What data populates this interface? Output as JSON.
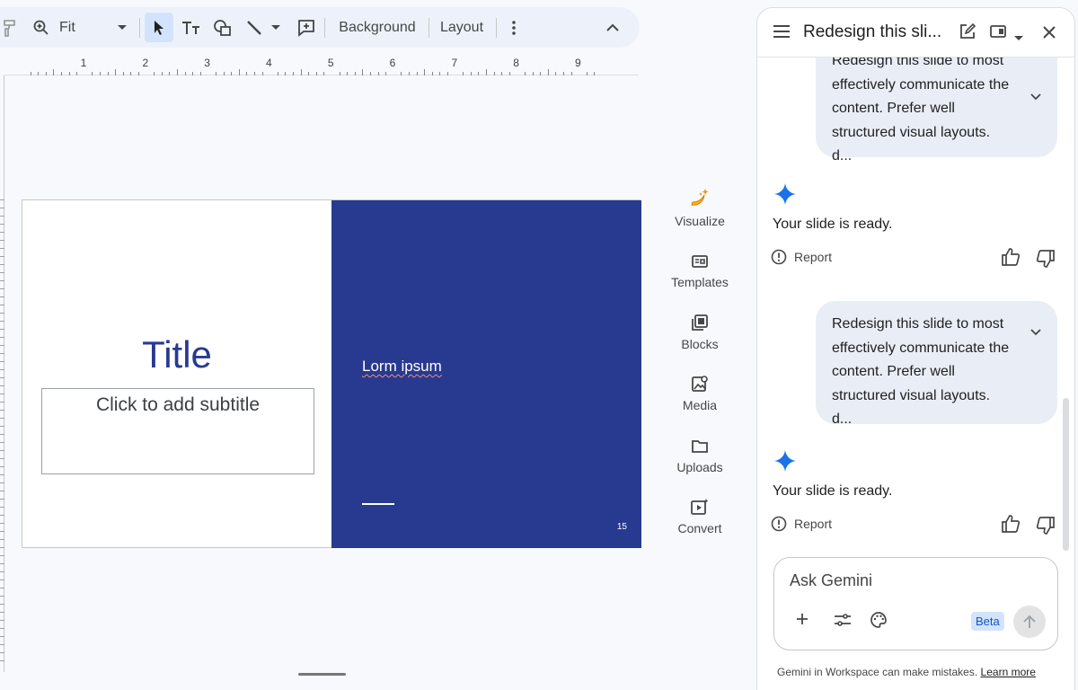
{
  "toolbar": {
    "zoom_value": "Fit",
    "background_label": "Background",
    "layout_label": "Layout"
  },
  "ruler": {
    "numbers": [
      "1",
      "2",
      "3",
      "4",
      "5",
      "6",
      "7",
      "8",
      "9"
    ]
  },
  "slide": {
    "title": "Title",
    "subtitle_placeholder": "Click to add subtitle",
    "body_text": "Lorm ipsum",
    "page_number": "15",
    "accent_color": "#283a8f"
  },
  "side_tools": [
    {
      "label": "Visualize",
      "icon": "banana-sparkle-icon"
    },
    {
      "label": "Templates",
      "icon": "templates-icon"
    },
    {
      "label": "Blocks",
      "icon": "blocks-icon"
    },
    {
      "label": "Media",
      "icon": "media-icon"
    },
    {
      "label": "Uploads",
      "icon": "folder-icon"
    },
    {
      "label": "Convert",
      "icon": "convert-icon"
    }
  ],
  "gemini": {
    "panel_title": "Redesign this sli...",
    "prompt_lines": [
      "Redesign this slide to most",
      "effectively communicate the",
      "content. Prefer well",
      "structured visual layouts. d..."
    ],
    "response_text": "Your slide is ready.",
    "report_label": "Report",
    "input_placeholder": "Ask Gemini",
    "beta_label": "Beta",
    "disclaimer": "Gemini in Workspace can make mistakes.",
    "learn_more": "Learn more",
    "accent_color": "#1a73e8"
  }
}
